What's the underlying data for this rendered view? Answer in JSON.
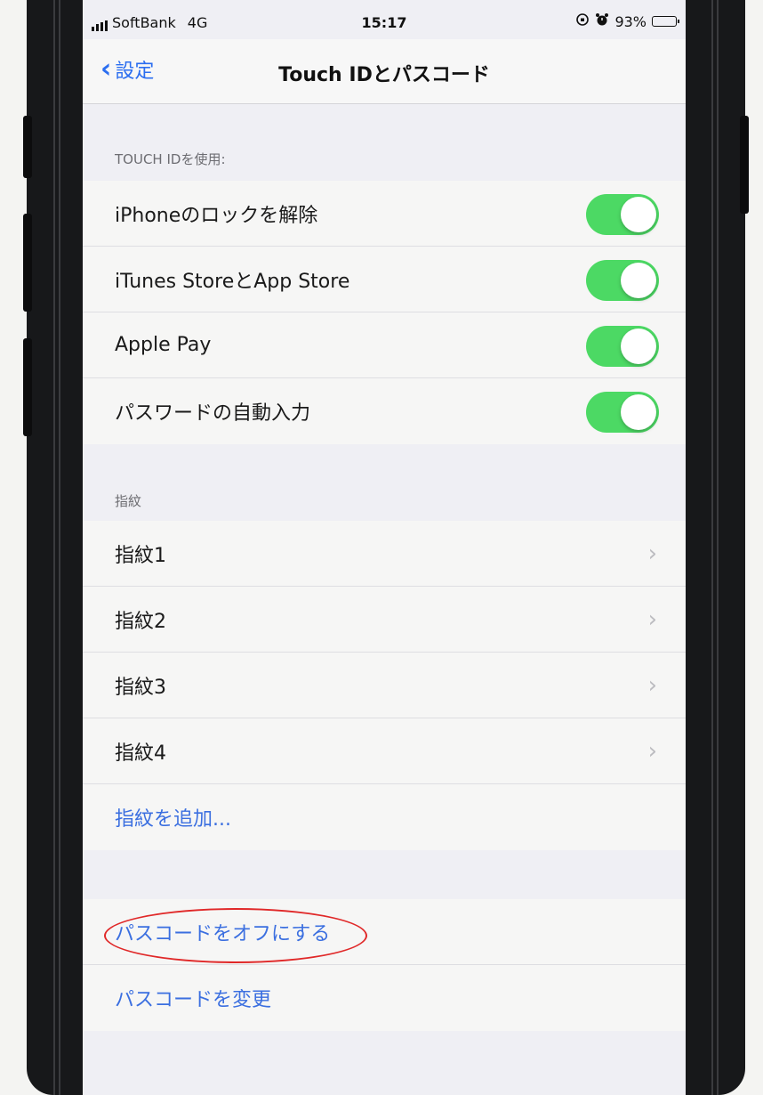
{
  "status_bar": {
    "carrier": "SoftBank",
    "network": "4G",
    "time": "15:17",
    "battery": "93%"
  },
  "nav": {
    "back_label": "設定",
    "title": "Touch IDとパスコード"
  },
  "touch_id_section": {
    "header": "TOUCH IDを使用:",
    "items": [
      {
        "label": "iPhoneのロックを解除",
        "on": true
      },
      {
        "label": "iTunes StoreとApp Store",
        "on": true
      },
      {
        "label": "Apple Pay",
        "on": true
      },
      {
        "label": "パスワードの自動入力",
        "on": true
      }
    ]
  },
  "fingerprint_section": {
    "header": "指紋",
    "items": [
      {
        "label": "指紋1"
      },
      {
        "label": "指紋2"
      },
      {
        "label": "指紋3"
      },
      {
        "label": "指紋4"
      }
    ],
    "add_label": "指紋を追加..."
  },
  "passcode_section": {
    "turn_off_label": "パスコードをオフにする",
    "change_label": "パスコードを変更"
  },
  "colors": {
    "toggle_on": "#4cd964",
    "link_blue": "#3b6fe0",
    "highlight_circle": "#e02828"
  }
}
